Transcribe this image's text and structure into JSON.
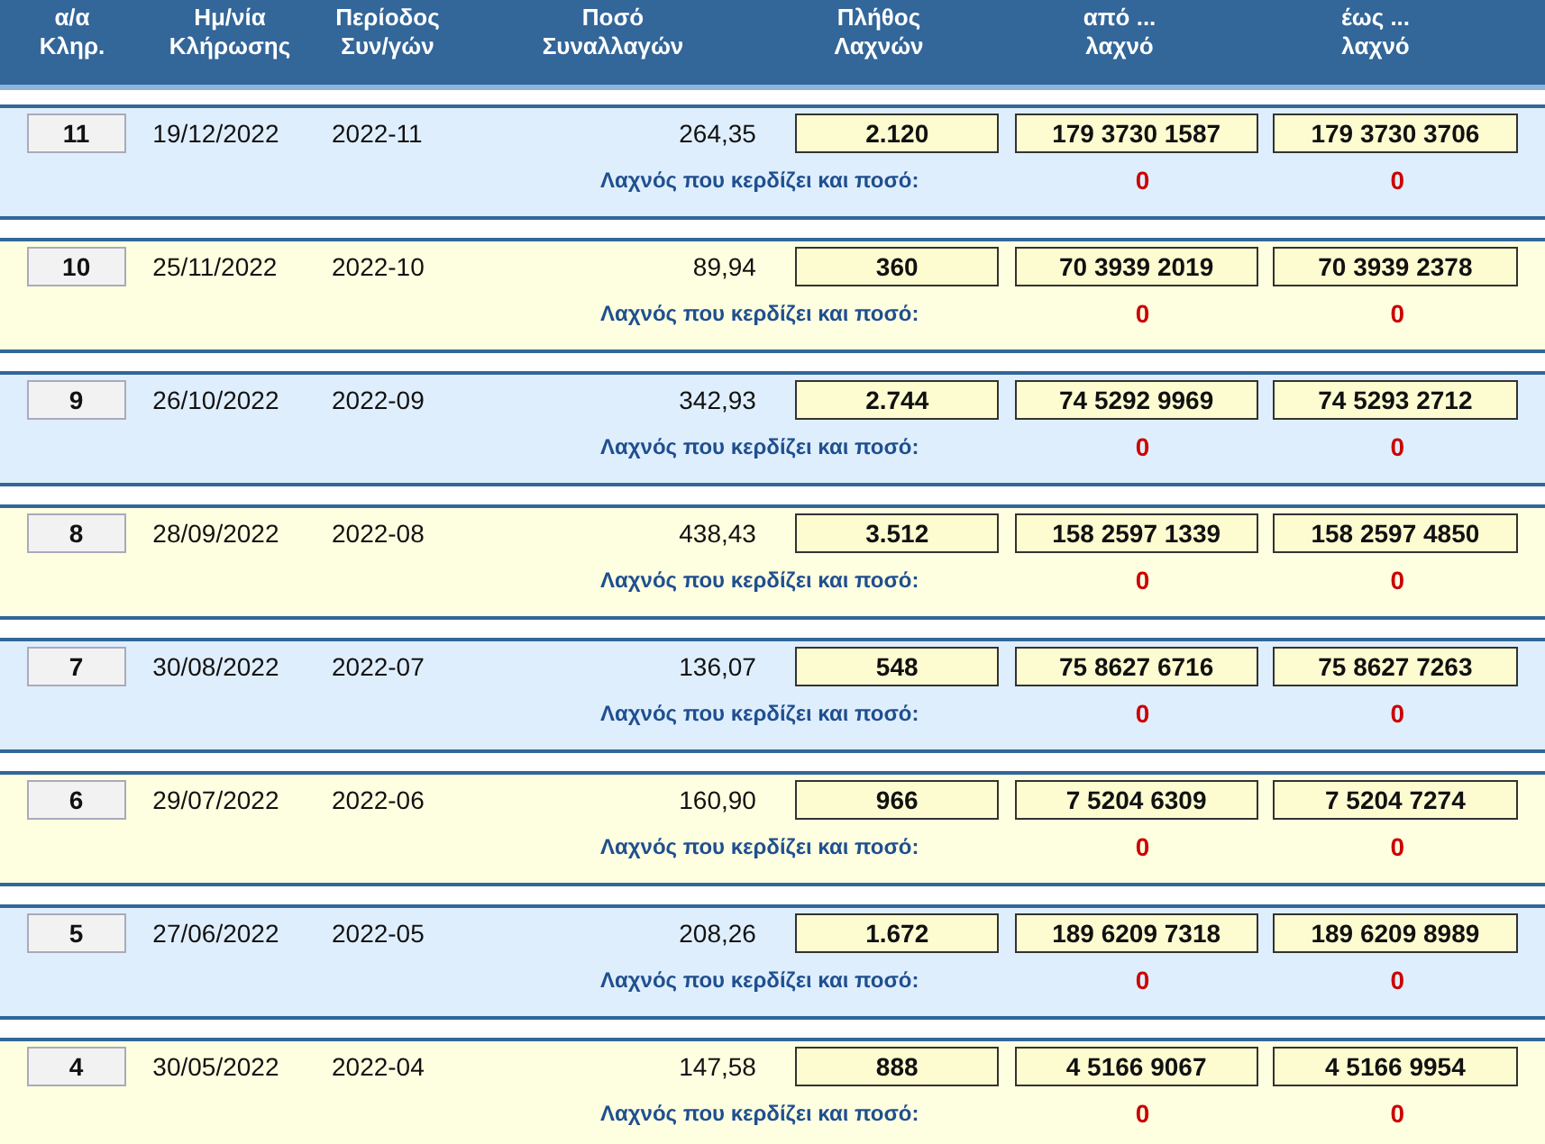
{
  "columns": [
    "α/α\nΚληρ.",
    "Ημ/νία\nΚλήρωσης",
    "Περίοδος\nΣυν/γών",
    "Ποσό\nΣυναλλαγών",
    "Πλήθος\nΛαχνών",
    "από ...\nλαχνό",
    "έως ...\nλαχνό"
  ],
  "draws": [
    {
      "no": "11",
      "date": "19/12/2022",
      "period": "2022-11",
      "amount": "264,35",
      "count": "2.120",
      "from": "179 3730 1587",
      "to": "179 3730 3706",
      "label": "Λαχνός που κερδίζει και ποσό:",
      "win_ticket": "0",
      "win_amount": "0",
      "color": "#dfeefc"
    },
    {
      "no": "10",
      "date": "25/11/2022",
      "period": "2022-10",
      "amount": "89,94",
      "count": "360",
      "from": "70 3939 2019",
      "to": "70 3939 2378",
      "label": "Λαχνός που κερδίζει και ποσό:",
      "win_ticket": "0",
      "win_amount": "0",
      "color": "#fefee0"
    },
    {
      "no": "9",
      "date": "26/10/2022",
      "period": "2022-09",
      "amount": "342,93",
      "count": "2.744",
      "from": "74 5292 9969",
      "to": "74 5293 2712",
      "label": "Λαχνός που κερδίζει και ποσό:",
      "win_ticket": "0",
      "win_amount": "0",
      "color": "#dfeefc"
    },
    {
      "no": "8",
      "date": "28/09/2022",
      "period": "2022-08",
      "amount": "438,43",
      "count": "3.512",
      "from": "158 2597 1339",
      "to": "158 2597 4850",
      "label": "Λαχνός που κερδίζει και ποσό:",
      "win_ticket": "0",
      "win_amount": "0",
      "color": "#fefee0"
    },
    {
      "no": "7",
      "date": "30/08/2022",
      "period": "2022-07",
      "amount": "136,07",
      "count": "548",
      "from": "75 8627 6716",
      "to": "75 8627 7263",
      "label": "Λαχνός που κερδίζει και ποσό:",
      "win_ticket": "0",
      "win_amount": "0",
      "color": "#dfeefc"
    },
    {
      "no": "6",
      "date": "29/07/2022",
      "period": "2022-06",
      "amount": "160,90",
      "count": "966",
      "from": "7 5204 6309",
      "to": "7 5204 7274",
      "label": "Λαχνός που κερδίζει και ποσό:",
      "win_ticket": "0",
      "win_amount": "0",
      "color": "#fefee0"
    },
    {
      "no": "5",
      "date": "27/06/2022",
      "period": "2022-05",
      "amount": "208,26",
      "count": "1.672",
      "from": "189 6209 7318",
      "to": "189 6209 8989",
      "label": "Λαχνός που κερδίζει και ποσό:",
      "win_ticket": "0",
      "win_amount": "0",
      "color": "#dfeefc"
    },
    {
      "no": "4",
      "date": "30/05/2022",
      "period": "2022-04",
      "amount": "147,58",
      "count": "888",
      "from": "4 5166 9067",
      "to": "4 5166 9954",
      "label": "Λαχνός που κερδίζει και ποσό:",
      "win_ticket": "0",
      "win_amount": "0",
      "color": "#fefee0"
    }
  ]
}
